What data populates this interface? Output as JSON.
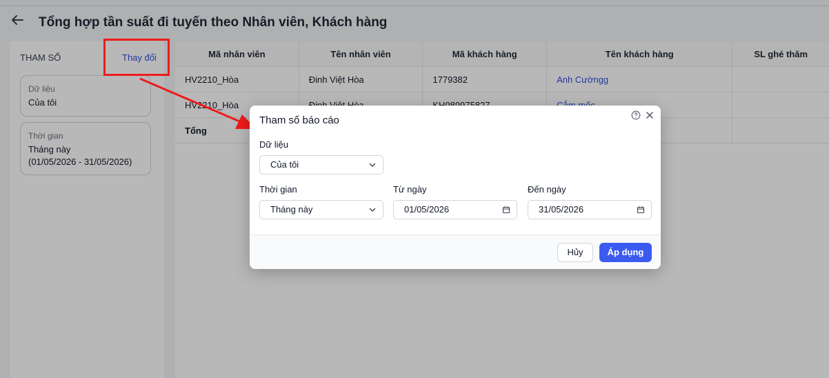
{
  "header": {
    "title": "Tổng hợp tần suất đi tuyến theo Nhân viên, Khách hàng"
  },
  "params": {
    "label": "THAM SỐ",
    "change_link": "Thay đổi",
    "data_card": {
      "label": "Dữ liệu",
      "value": "Của tôi"
    },
    "time_card": {
      "label": "Thời gian",
      "value": "Tháng này",
      "range": "(01/05/2026 - 31/05/2026)"
    }
  },
  "table": {
    "columns": [
      "Mã nhân viên",
      "Tên nhân viên",
      "Mã khách hàng",
      "Tên khách hàng",
      "SL ghé thăm"
    ],
    "rows": [
      [
        "HV2210_Hòa",
        "Đinh Việt Hòa",
        "1779382",
        "Anh Cườngg",
        ""
      ],
      [
        "HV2210_Hòa",
        "Đinh Việt Hòa",
        "KH989975827",
        "Cắm mốc",
        ""
      ]
    ],
    "total_label": "Tổng"
  },
  "dialog": {
    "title": "Tham số báo cáo",
    "data_label": "Dữ liệu",
    "data_value": "Của tôi",
    "time_label": "Thời gian",
    "time_value": "Tháng này",
    "from_label": "Từ ngày",
    "from_value": "01/05/2026",
    "to_label": "Đến ngày",
    "to_value": "31/05/2026",
    "cancel": "Hủy",
    "apply": "Áp dụng"
  },
  "colors": {
    "accent": "#3b5bf0",
    "link": "#2f4fdb",
    "annotation": "#ee1b1b"
  },
  "icons": [
    "back-arrow-icon",
    "help-circle-icon",
    "close-icon",
    "chevron-down-icon",
    "calendar-icon"
  ]
}
